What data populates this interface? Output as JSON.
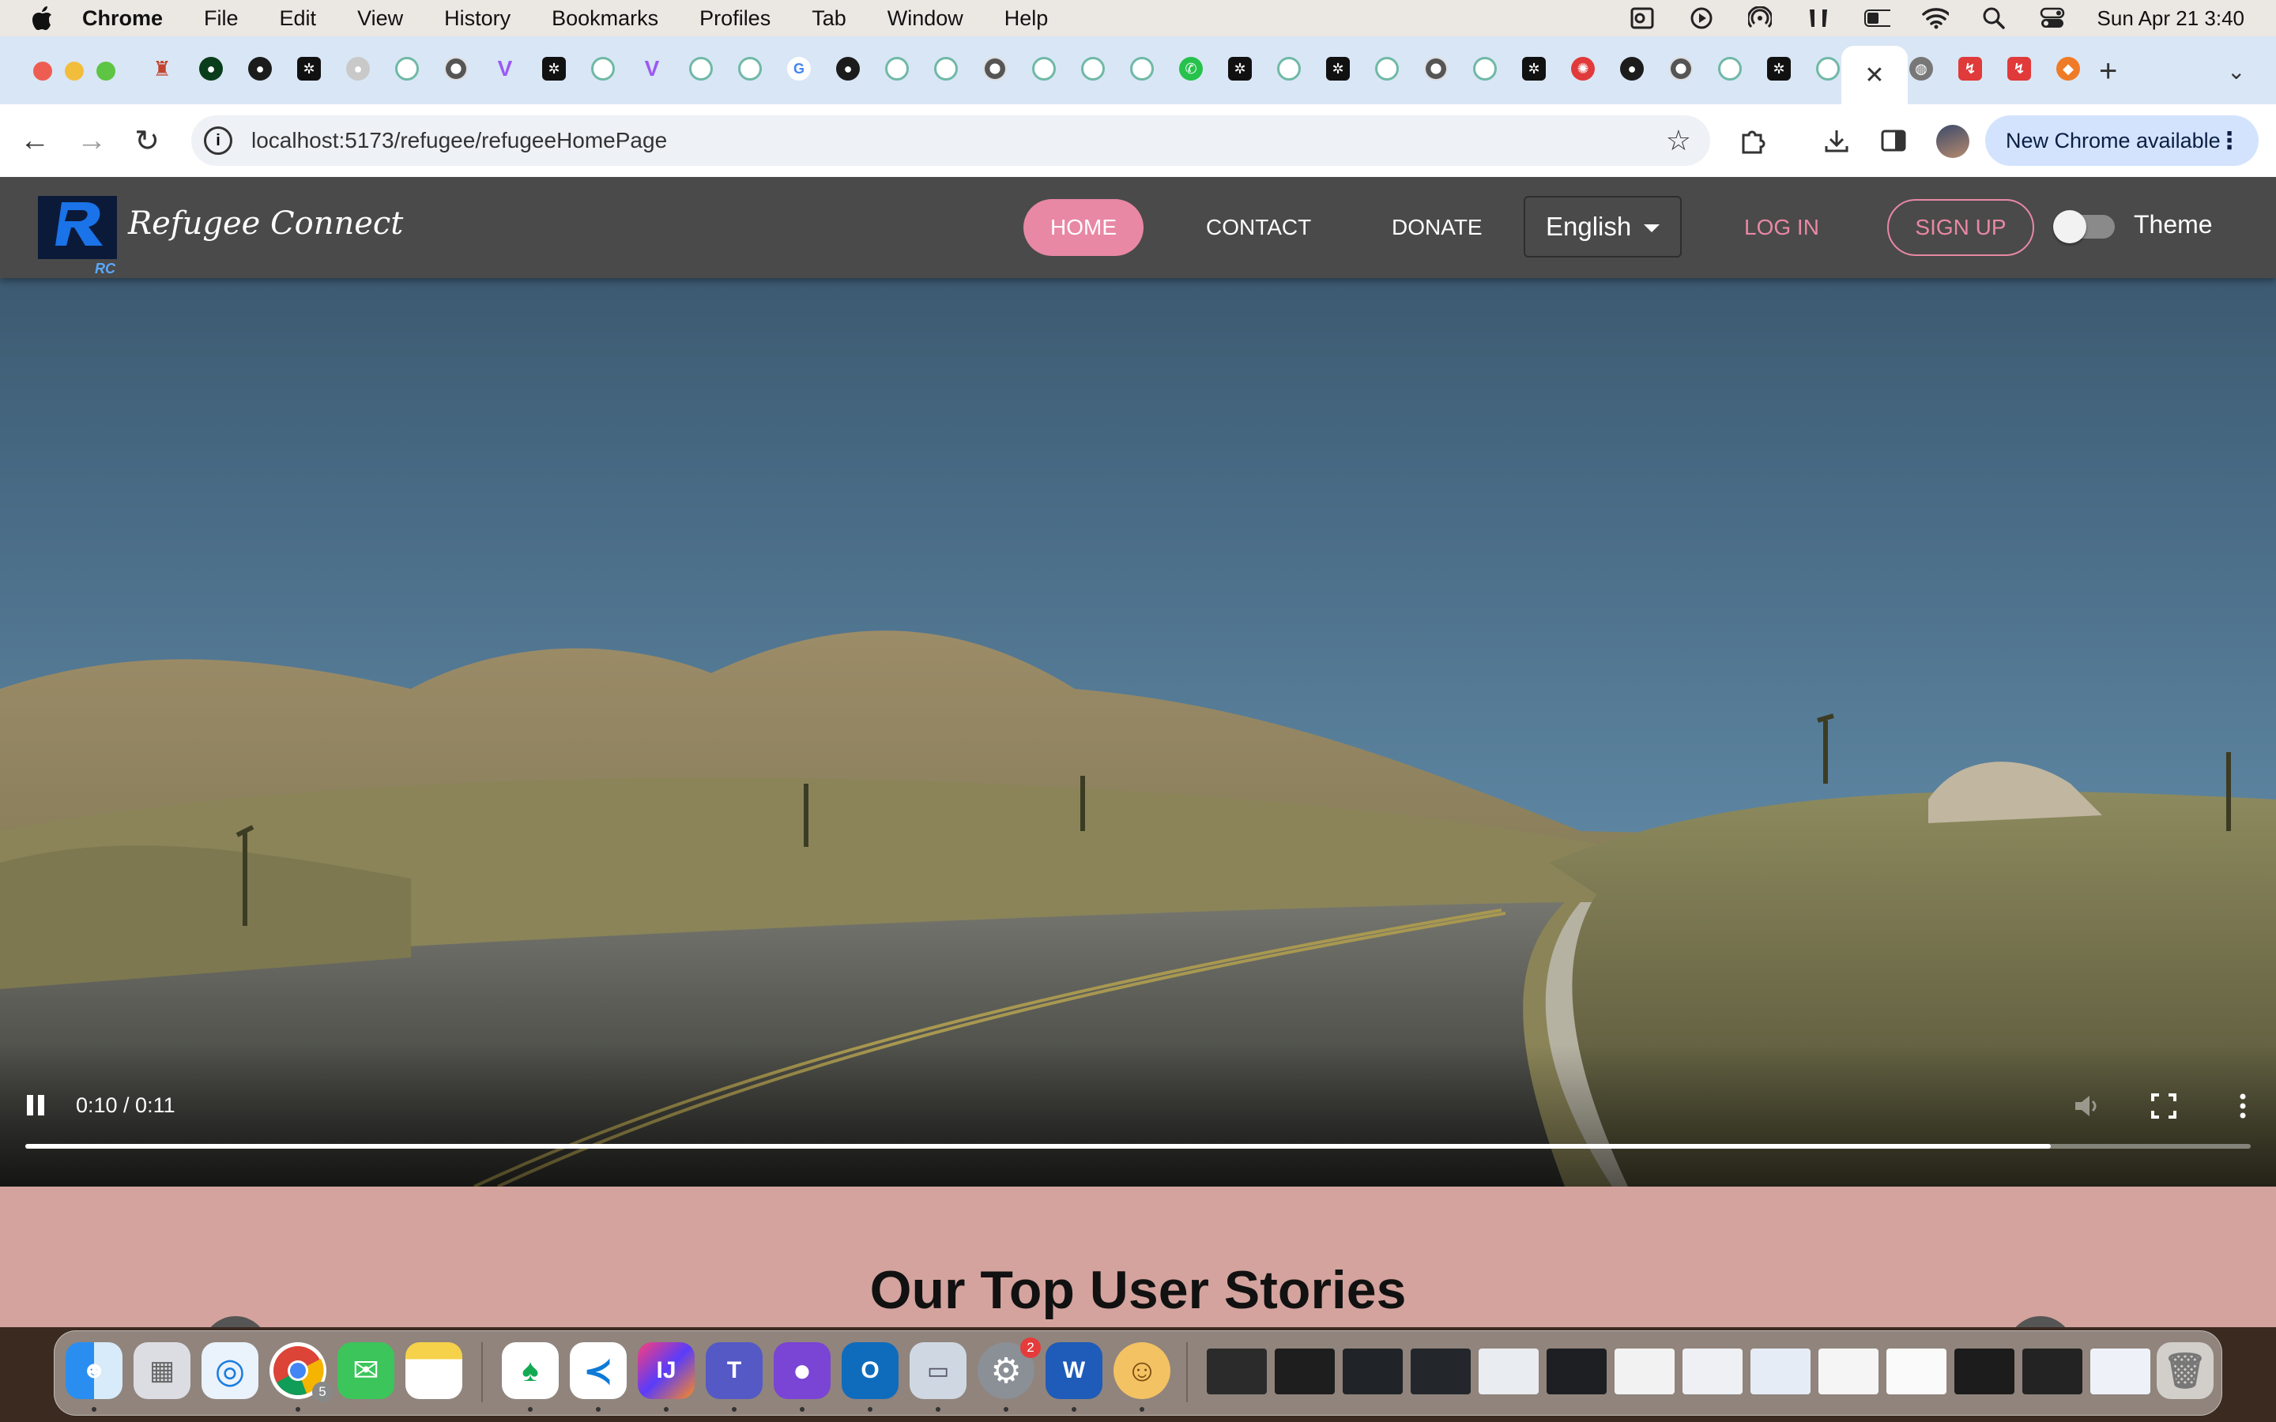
{
  "menubar": {
    "app_name": "Chrome",
    "items": [
      "File",
      "Edit",
      "View",
      "History",
      "Bookmarks",
      "Profiles",
      "Tab",
      "Window",
      "Help"
    ],
    "clock": "Sun Apr 21  3:40",
    "battery_level": 0.4
  },
  "browser": {
    "active_tab_close": "✕",
    "new_tab": "+",
    "url": "localhost:5173/refugee/refugeeHomePage",
    "update_pill": "New Chrome available"
  },
  "site": {
    "brand": "Refugee Connect",
    "logo_text": "RC",
    "nav": {
      "home": "HOME",
      "contact": "CONTACT",
      "donate": "DONATE",
      "login": "LOG IN",
      "signup": "SIGN UP",
      "theme": "Theme"
    },
    "language": "English",
    "theme_toggle_on": false,
    "accent_color": "#e888a4"
  },
  "video": {
    "timecode": "0:10 / 0:11",
    "progress": 0.91,
    "state": "playing"
  },
  "stories": {
    "heading": "Our Top User Stories"
  },
  "dock": {
    "chrome_badge": "5",
    "settings_badge": "2"
  }
}
